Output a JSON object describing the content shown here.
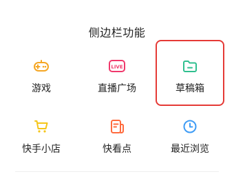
{
  "title": "侧边栏功能",
  "items": [
    {
      "label": "游戏",
      "icon": "gamepad-icon",
      "color": "#f5a623"
    },
    {
      "label": "直播广场",
      "icon": "live-tv-icon",
      "color": "#f0386b"
    },
    {
      "label": "草稿箱",
      "icon": "folder-icon",
      "color": "#2fbf8f"
    },
    {
      "label": "快手小店",
      "icon": "shopping-cart-icon",
      "color": "#f5c518"
    },
    {
      "label": "快看点",
      "icon": "news-icon",
      "color": "#ff6a3d"
    },
    {
      "label": "最近浏览",
      "icon": "clock-icon",
      "color": "#3d9bf5"
    }
  ],
  "live_badge_text": "LIVE"
}
